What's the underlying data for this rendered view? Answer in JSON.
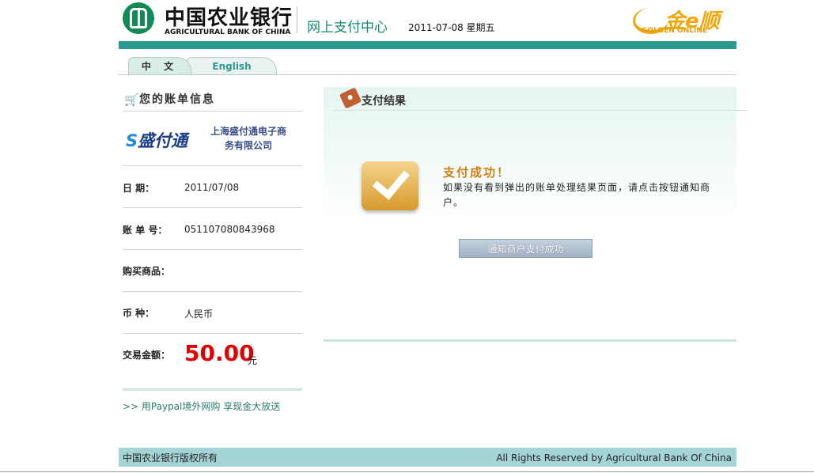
{
  "header": {
    "bank_name_cn": "中国农业银行",
    "bank_name_en": "AGRICULTURAL BANK OF CHINA",
    "portal_title": "网上支付中心",
    "date": "2011-07-08 星期五",
    "partner_logo": "金e顺",
    "partner_sub": "GOLDEN ONLINE",
    "brand_color": "#118a55",
    "accent_color": "#2c9a8e"
  },
  "tabs": [
    {
      "label": "中 文",
      "active": true
    },
    {
      "label": "English",
      "active": false
    }
  ],
  "bill": {
    "title": "您的账单信息",
    "merchant_logo": "盛付通",
    "merchant_name": "上海盛付通电子商务有限公司",
    "rows": [
      {
        "label": "日  期：",
        "value": "2011/07/08"
      },
      {
        "label": "账 单 号：",
        "value": "051107080843968"
      },
      {
        "label": "购买商品：",
        "value": ""
      },
      {
        "label": "币  种：",
        "value": "人民币"
      },
      {
        "label": "交易金额：",
        "value": "50.00"
      }
    ],
    "amount_unit": "元",
    "promo_link": ">> 用Paypal境外网购 享现金大放送"
  },
  "result": {
    "title": "支付结果",
    "success_title": "支付成功！",
    "success_message": "如果没有看到弹出的账单处理结果页面，请点击按钮通知商户。",
    "notify_button": "通知商户支付成功"
  },
  "footer": {
    "left": "中国农业银行版权所有",
    "right": "All Rights Reserved by Agricultural Bank Of China"
  }
}
